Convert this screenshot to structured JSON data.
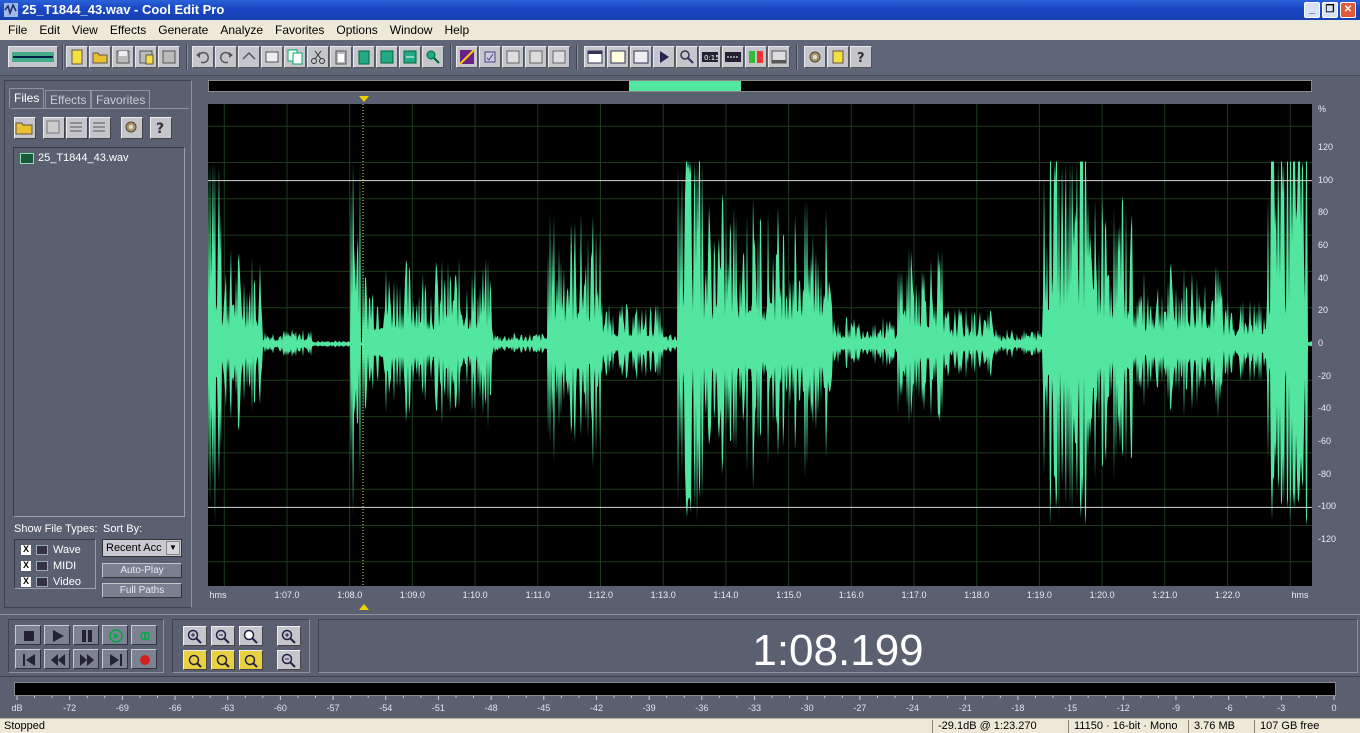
{
  "window": {
    "title": "25_T1844_43.wav - Cool Edit Pro",
    "controls": [
      "_",
      "❐",
      "✕"
    ]
  },
  "menu": [
    "File",
    "Edit",
    "View",
    "Effects",
    "Generate",
    "Analyze",
    "Favorites",
    "Options",
    "Window",
    "Help"
  ],
  "left_panel": {
    "tabs": [
      "Files",
      "Effects",
      "Favorites"
    ],
    "files": [
      "25_T1844_43.wav"
    ],
    "show_file_types_label": "Show File Types:",
    "sort_by_label": "Sort By:",
    "file_types": [
      {
        "label": "Wave",
        "checked": "X"
      },
      {
        "label": "MIDI",
        "checked": "X"
      },
      {
        "label": "Video",
        "checked": "X"
      }
    ],
    "sort_value": "Recent Acc",
    "auto_play_label": "Auto-Play",
    "full_paths_label": "Full Paths"
  },
  "waveform": {
    "color": "#52e6a0",
    "db_scale_unit": "%",
    "db_scale": [
      "120",
      "100",
      "80",
      "60",
      "40",
      "20",
      "0",
      "-20",
      "-40",
      "-60",
      "-80",
      "-100",
      "-120"
    ],
    "time_axis_start": "hms",
    "time_axis_end": "hms",
    "time_labels": [
      "1:07.0",
      "1:08.0",
      "1:09.0",
      "1:10.0",
      "1:11.0",
      "1:12.0",
      "1:13.0",
      "1:14.0",
      "1:15.0",
      "1:16.0",
      "1:17.0",
      "1:18.0",
      "1:19.0",
      "1:20.0",
      "1:21.0",
      "1:22.0"
    ]
  },
  "transport": {
    "time": "1:08.199"
  },
  "meter": {
    "labels": [
      "dB",
      "-72",
      "-69",
      "-66",
      "-63",
      "-60",
      "-57",
      "-54",
      "-51",
      "-48",
      "-45",
      "-42",
      "-39",
      "-36",
      "-33",
      "-30",
      "-27",
      "-24",
      "-21",
      "-18",
      "-15",
      "-12",
      "-9",
      "-6",
      "-3",
      "0"
    ]
  },
  "status": {
    "state": "Stopped",
    "level_at": "-29.1dB @  1:23.270",
    "format": "11150 · 16-bit · Mono",
    "size": "3.76 MB",
    "free": "107 GB free"
  }
}
